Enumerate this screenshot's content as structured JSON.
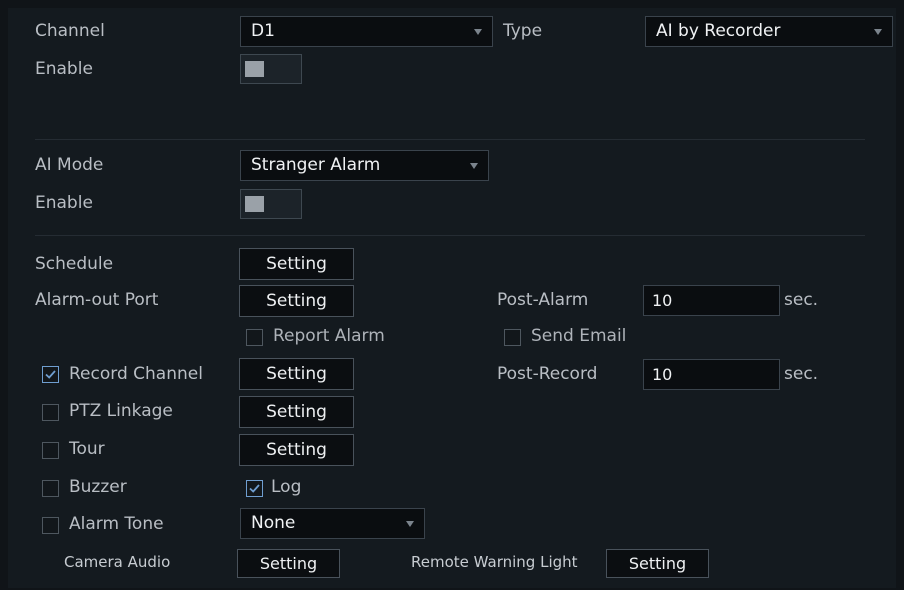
{
  "top": {
    "channel_label": "Channel",
    "channel_value": "D1",
    "type_label": "Type",
    "type_value": "AI by Recorder",
    "enable_label": "Enable",
    "enable_on": false
  },
  "ai": {
    "mode_label": "AI Mode",
    "mode_value": "Stranger Alarm",
    "enable_label": "Enable",
    "enable_on": false
  },
  "actions": {
    "schedule_label": "Schedule",
    "alarm_out_label": "Alarm-out Port",
    "setting_label": "Setting",
    "post_alarm_label": "Post-Alarm",
    "post_alarm_value": "10",
    "sec_unit": "sec.",
    "report_alarm_label": "Report Alarm",
    "report_alarm_checked": false,
    "send_email_label": "Send Email",
    "send_email_checked": false,
    "record_channel_label": "Record Channel",
    "record_channel_checked": true,
    "post_record_label": "Post-Record",
    "post_record_value": "10",
    "ptz_linkage_label": "PTZ Linkage",
    "ptz_linkage_checked": false,
    "tour_label": "Tour",
    "tour_checked": false,
    "buzzer_label": "Buzzer",
    "buzzer_checked": false,
    "log_label": "Log",
    "log_checked": true,
    "alarm_tone_label": "Alarm Tone",
    "alarm_tone_checked": false,
    "alarm_tone_value": "None",
    "camera_audio_label": "Camera Audio",
    "remote_warning_light_label": "Remote Warning Light"
  },
  "colors": {
    "background": "#141a1f",
    "check_accent": "#6f9ed0"
  }
}
